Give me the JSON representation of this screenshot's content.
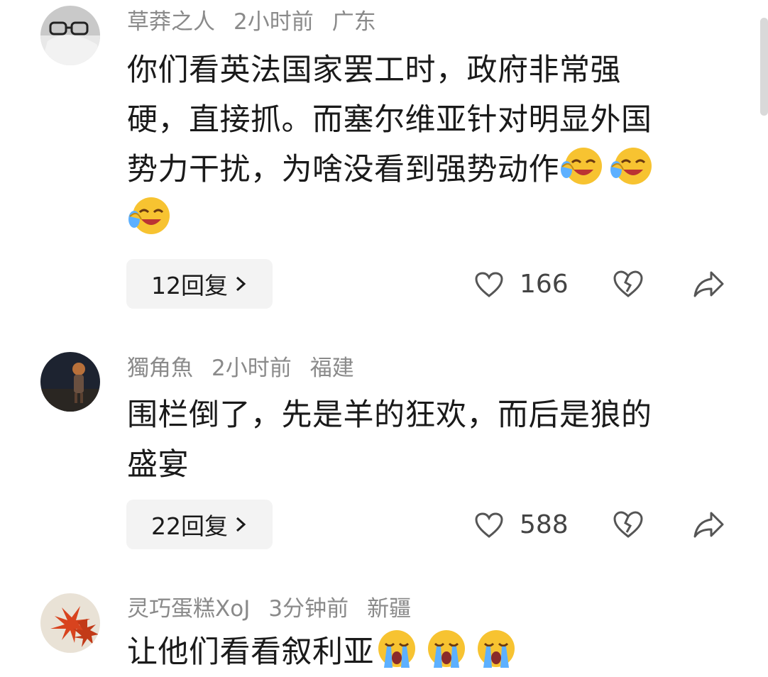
{
  "comments": [
    {
      "username": "草莽之人",
      "time": "2小时前",
      "location": "广东",
      "text_lines": [
        "你们看英法国家罢工时，政府非常强",
        "硬，直接抓。而塞尔维亚针对明显外国",
        "势力干扰，为啥没看到强势动作"
      ],
      "emoji": "face-with-tears-of-joy",
      "reply_label": "12回复",
      "likes": "166"
    },
    {
      "username": "獨角魚",
      "time": "2小时前",
      "location": "福建",
      "text_lines": [
        "围栏倒了，先是羊的狂欢，而后是狼的",
        "盛宴"
      ],
      "reply_label": "22回复",
      "likes": "588"
    },
    {
      "username": "灵巧蛋糕XoJ",
      "time": "3分钟前",
      "location": "新疆",
      "text_lines": [
        "让他们看看叙利亚"
      ],
      "emoji": "loudly-crying-face"
    }
  ],
  "colors": {
    "meta": "#8a8a8a",
    "reply_bg": "#f3f3f3",
    "emoji_yellow": "#f7c331"
  }
}
